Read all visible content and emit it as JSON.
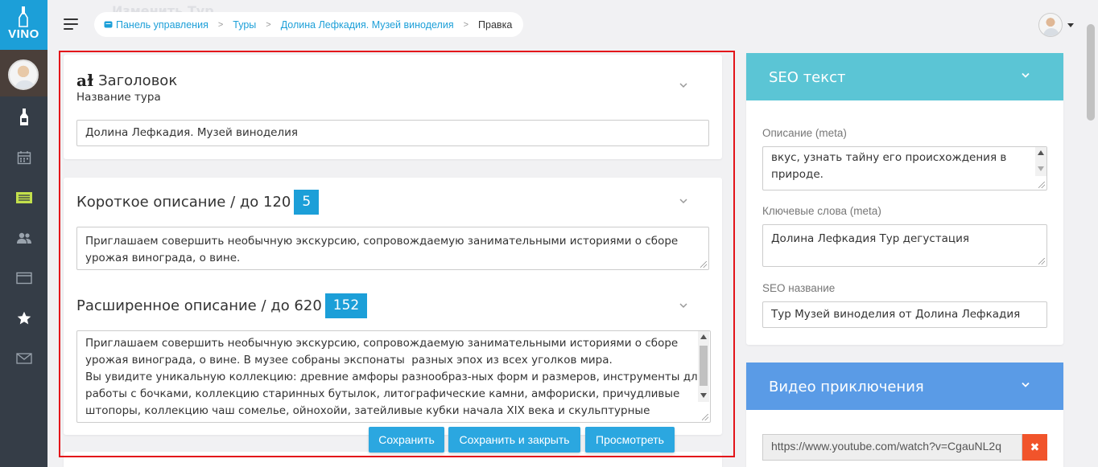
{
  "app": {
    "logo_text": "VINO",
    "ghost_title": "Изменить Тур"
  },
  "breadcrumb": {
    "items": [
      "Панель управления",
      "Туры",
      "Долина Лефкадия. Музей виноделия"
    ],
    "current": "Правка"
  },
  "sidebar": {
    "icons": [
      "bottle-icon",
      "calendar-icon",
      "list-icon",
      "users-icon",
      "window-icon",
      "star-icon",
      "mail-icon"
    ],
    "active_color": "#c3e04c"
  },
  "title_card": {
    "heading": "Заголовок",
    "subheading": "Название тура",
    "value": "Долина Лефкадия. Музей виноделия"
  },
  "short_desc": {
    "heading": "Короткое описание / до 120",
    "count": "5",
    "value": "Приглашаем совершить необычную экскурсию, сопровождаемую занимательными историями о сборе урожая винограда, о вине."
  },
  "long_desc": {
    "heading": "Расширенное описание / до 620",
    "count": "152",
    "line1": "Приглашаем совершить необычную экскурсию, сопровождаемую занимательными историями о сборе",
    "line2": "урожая винограда, о вине. В музее собраны экспонаты  разных эпох из всех уголков мира.",
    "line3": "Вы увидите уникальную коллекцию: древние амфоры разнообраз-ных форм и размеров, инструменты для",
    "line4": "работы с бочками, коллекцию старинных бутылок, литографические камни, амфориски, причудливые",
    "line5": "штопоры, коллекцию чаш сомелье, ойнохойи, затейливые кубки начала XIX века и скульптурные"
  },
  "actions": {
    "save": "Сохранить",
    "save_close": "Сохранить и закрыть",
    "preview": "Просмотреть"
  },
  "seo": {
    "header": "SEO текст",
    "meta_desc_label": "Описание (meta)",
    "meta_desc_line1": "вкус, узнать тайну его происхождения в",
    "meta_desc_line2": "природе.",
    "keywords_label": "Ключевые слова (meta)",
    "keywords_value": "Долина Лефкадия Тур дегустация",
    "seo_name_label": "SEO название",
    "seo_name_value": "Тур Музей виноделия от Долина Лефкадия"
  },
  "video": {
    "header": "Видео приключения",
    "url": "https://www.youtube.com/watch?v=CgauNL2q",
    "delete_symbol": "✖"
  },
  "colors": {
    "brand_blue": "#1c9fd8",
    "seo_header": "#5bc5d5",
    "video_header": "#5a9be6",
    "highlight_red": "#e3141a",
    "delete_red": "#f1542b"
  }
}
